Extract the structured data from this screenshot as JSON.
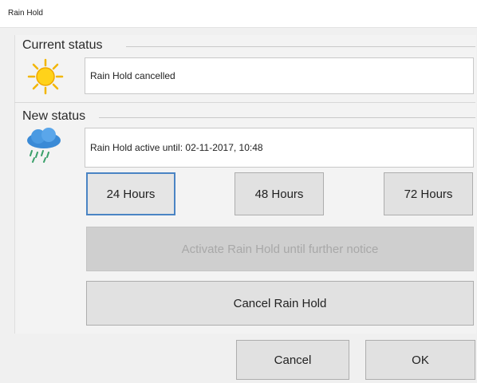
{
  "window": {
    "title": "Rain Hold"
  },
  "current_status": {
    "label": "Current status",
    "icon": "sun-icon",
    "value": "Rain Hold cancelled"
  },
  "new_status": {
    "label": "New status",
    "icon": "rain-cloud-icon",
    "value": "Rain Hold active until: 02-11-2017, 10:48"
  },
  "duration_buttons": [
    {
      "label": "24 Hours",
      "selected": true
    },
    {
      "label": "48 Hours",
      "selected": false
    },
    {
      "label": "72 Hours",
      "selected": false
    }
  ],
  "actions": {
    "activate_label": "Activate Rain Hold until further notice",
    "cancel_hold_label": "Cancel Rain Hold"
  },
  "dialog_buttons": {
    "cancel_label": "Cancel",
    "ok_label": "OK"
  },
  "colors": {
    "selected_border": "#4a84c4",
    "sun": "#f5c200",
    "cloud": "#3a8ad6",
    "rain": "#3aa06a"
  }
}
